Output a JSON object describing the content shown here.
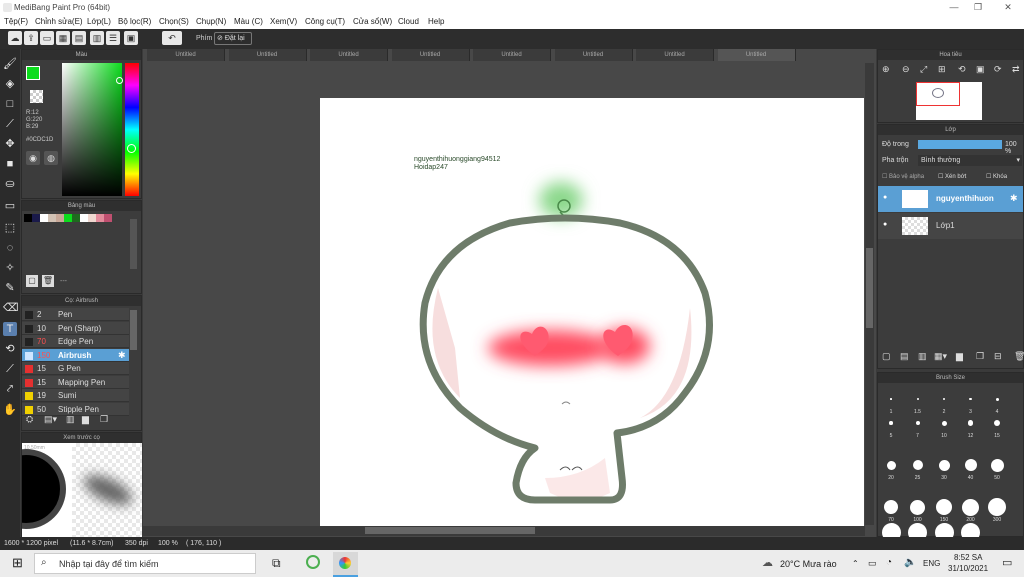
{
  "window": {
    "title": "MediBang Paint Pro (64bit)"
  },
  "menu": [
    "Tệp(F)",
    "Chỉnh sửa(E)",
    "Lớp(L)",
    "Bộ lọc(R)",
    "Chọn(S)",
    "Chụp(N)",
    "Màu (C)",
    "Xem(V)",
    "Công cụ(T)",
    "Cửa sổ(W)",
    "Cloud",
    "Help"
  ],
  "toolbar": {
    "snap_label": "Phím",
    "reset_label": "Đặt lại"
  },
  "color_panel": {
    "title": "Màu",
    "r": "R:12",
    "g": "G:220",
    "b": "B:29",
    "hex": "#0CDC1D",
    "primary_color": "#0cdc1d"
  },
  "palette_panel": {
    "title": "Bảng màu",
    "pagination": "---",
    "swatches": [
      "#000000",
      "#1a1a4a",
      "#ffffff",
      "#d2c2b4",
      "#c8a898",
      "#0cdc1d",
      "#1e6b1e",
      "#ffffff",
      "#f0d8d0",
      "#e38b9b",
      "#c05070"
    ]
  },
  "brush_panel": {
    "title": "Cọ: Airbrush",
    "brushes": [
      {
        "size": "2",
        "name": "Pen",
        "color": "#222222"
      },
      {
        "size": "10",
        "name": "Pen (Sharp)",
        "color": "#222222"
      },
      {
        "size": "70",
        "name": "Edge Pen",
        "color": "#222222"
      },
      {
        "size": "150",
        "name": "Airbrush",
        "color": "#cfe6ff"
      },
      {
        "size": "15",
        "name": "G Pen",
        "color": "#e53030"
      },
      {
        "size": "15",
        "name": "Mapping Pen",
        "color": "#e53030"
      },
      {
        "size": "19",
        "name": "Sumi",
        "color": "#f0d000"
      },
      {
        "size": "50",
        "name": "Stipple Pen",
        "color": "#f0d000"
      }
    ]
  },
  "brush_preview": {
    "title": "Xem trước cọ",
    "size_label": "10.50mm"
  },
  "tabs": [
    "Untitled",
    "Untitled",
    "Untitled",
    "Untitled",
    "Untitled",
    "Untitled",
    "Untitled",
    "Untitled"
  ],
  "canvas_text": {
    "line1": "nguyenthihuonggiang94512",
    "line2": "Hoidap247"
  },
  "navigator": {
    "title": "Hoa tiêu"
  },
  "layer_panel": {
    "title": "Lớp",
    "opacity_label": "Độ trong",
    "opacity_value": "100 %",
    "opacity": 1.0,
    "blend_label": "Pha trộn",
    "blend_value": "Bình thường",
    "protect_alpha": "Bảo vệ alpha",
    "clipping": "Xén bớt",
    "lock": "Khóa",
    "layers": [
      {
        "name": "nguyenthihuon"
      },
      {
        "name": "Lớp1"
      }
    ]
  },
  "brush_size_panel": {
    "title": "Brush Size",
    "row1": [
      "1",
      "1.5",
      "2",
      "3",
      "4"
    ],
    "row2": [
      "5",
      "7",
      "10",
      "12",
      "15"
    ],
    "row3": [
      "20",
      "25",
      "30",
      "40",
      "50"
    ],
    "row4": [
      "70",
      "100",
      "150",
      "200",
      "300"
    ]
  },
  "status": {
    "doc_size": "1600 * 1200 pixel",
    "doc_cm": "(11.6 * 8.7cm)",
    "dpi": "350 dpi",
    "zoom": "100 %",
    "coords": "( 176, 110 )"
  },
  "taskbar": {
    "search_placeholder": "Nhập tại đây để tìm kiếm",
    "weather": "20°C  Mưa rào",
    "lang": "ENG",
    "time": "8:52 SA",
    "date": "31/10/2021"
  }
}
